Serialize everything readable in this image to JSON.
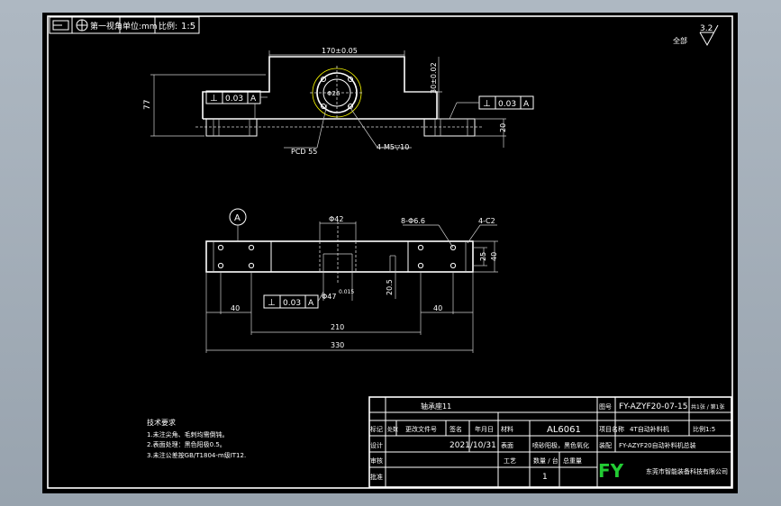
{
  "title_strip": {
    "icon_text": "",
    "item1": "第一视角",
    "item2": "单位:mm",
    "item3_label": "比例:",
    "item3_value": "1:5"
  },
  "surface_finish": {
    "prefix": "全部",
    "value": "3.2"
  },
  "front_view": {
    "dim_width": "170±0.05",
    "dim_height_total": "77",
    "dim_step": "30±0.02",
    "dim_bar": "20",
    "pcd": "PCD 55",
    "holes": "4-M5▽10",
    "bore": "Φ26",
    "gdt_left": {
      "symbol": "⊥",
      "tol": "0.03",
      "datum": "A"
    },
    "gdt_right": {
      "symbol": "⊥",
      "tol": "0.03",
      "datum": "A"
    }
  },
  "top_view": {
    "datum_label": "A",
    "dim_bore": "Φ42",
    "holes": "8-Φ6.6",
    "chamfer": "4-C2",
    "dim_25": "25",
    "dim_40_right": "40",
    "dim_left_40": "40",
    "dim_right_40": "40",
    "dim_210": "210",
    "dim_330": "330",
    "dim_205": "20.5",
    "dim_bore2": "Φ47",
    "dim_bore2_tol": "0.015",
    "gdt_bottom": {
      "symbol": "⊥",
      "tol": "0.03",
      "datum": "A"
    }
  },
  "notes": {
    "title": "技术要求",
    "lines": [
      "1.未注尖角、毛刺均需倒钝。",
      "2.表面处理：黑色阳极0.5。",
      "3.未注公差按GB/T1804-m级IT12."
    ]
  },
  "title_block": {
    "part_name": "轴承座11",
    "drawing_no": "FY-AZYF20-07-15",
    "sheet_label": "共1张 / 第1张",
    "material": "AL6061",
    "scale_text": "比例1:5",
    "project": "4T自动补料机",
    "assembly": "FY-AZYF20自动补料机总装",
    "date": "2021/10/31",
    "surface": "喷砂阳极，黑色氧化",
    "qty_label": "数量 / 台",
    "qty": "1",
    "weight_label": "总重量",
    "logo": "FY",
    "company": "东莞市智能装备科技有限公司",
    "row_labels": {
      "mark": "标记",
      "count": "处数",
      "change_doc": "更改文件号",
      "sign": "签名",
      "ymd": "年月日",
      "design": "设计",
      "standard": "标准化",
      "process": "工艺",
      "audit": "审核",
      "approve": "批准",
      "mat_label": "材料",
      "proj_label": "项目名称",
      "asm_label": "装配",
      "surf_label": "表面",
      "dwg_label": "图号"
    }
  }
}
